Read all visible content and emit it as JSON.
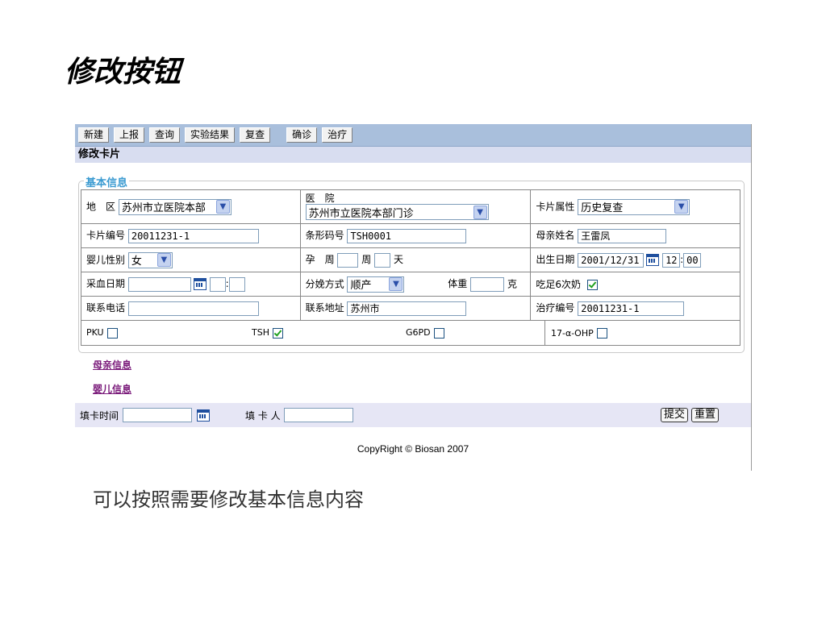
{
  "slide": {
    "title": "修改按钮",
    "caption": "可以按照需要修改基本信息内容"
  },
  "toolbar": {
    "buttons": [
      "新建",
      "上报",
      "查询",
      "实验结果",
      "复查",
      "确诊",
      "治疗"
    ]
  },
  "card_title": "修改卡片",
  "basic_info": {
    "legend": "基本信息",
    "region_label": "地　区",
    "region_value": "苏州市立医院本部",
    "hospital_label": "医　院",
    "hospital_value": "苏州市立医院本部门诊",
    "card_attr_label": "卡片属性",
    "card_attr_value": "历史复查",
    "card_no_label": "卡片编号",
    "card_no_value": "20011231-1",
    "barcode_label": "条形码号",
    "barcode_value": "TSH0001",
    "mother_name_label": "母亲姓名",
    "mother_name_value": "王雷凤",
    "baby_sex_label": "婴儿性别",
    "baby_sex_value": "女",
    "pregnancy_label": "孕　周",
    "week_unit": "周",
    "day_unit": "天",
    "birth_date_label": "出生日期",
    "birth_date_value": "2001/12/31",
    "birth_hour": "12",
    "birth_minute": "00",
    "time_sep": ":",
    "blood_date_label": "采血日期",
    "delivery_label": "分娩方式",
    "delivery_value": "顺产",
    "weight_label": "体重",
    "weight_unit": "克",
    "milk_label": "吃足6次奶",
    "phone_label": "联系电话",
    "address_label": "联系地址",
    "address_value": "苏州市",
    "treatment_no_label": "治疗编号",
    "treatment_no_value": "20011231-1",
    "pku_label": "PKU",
    "tsh_label": "TSH",
    "g6pd_label": "G6PD",
    "ohp_label": "17-α-OHP",
    "checks": {
      "milk": true,
      "pku": false,
      "tsh": true,
      "g6pd": false,
      "ohp": false
    }
  },
  "links": {
    "mother_info": "母亲信息",
    "baby_info": "婴儿信息"
  },
  "footer_form": {
    "fill_time_label": "填卡时间",
    "filler_label": "填 卡 人",
    "submit_label": "提交",
    "reset_label": "重置"
  },
  "copyright": "CopyRight © Biosan 2007"
}
